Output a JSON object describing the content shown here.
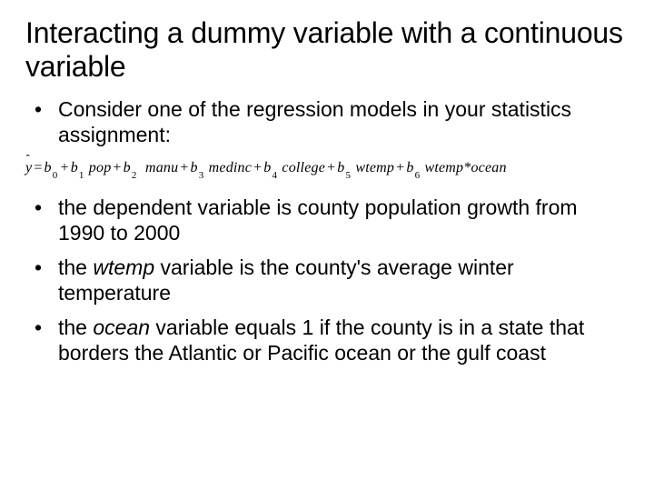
{
  "title": "Interacting a dummy variable with a continuous variable",
  "bullets_top": [
    "Consider one of the regression models in your statistics assignment:"
  ],
  "equation": {
    "yhat": "y",
    "eq": "=",
    "plus": "+",
    "star": "*",
    "b": "b",
    "sub0": "0",
    "sub1": "1",
    "sub2": "2",
    "sub3": "3",
    "sub4": "4",
    "sub5": "5",
    "sub6": "6",
    "pop": "pop",
    "manu": "manu",
    "medinc": "medinc",
    "college": "college",
    "wtemp": "wtemp",
    "ocean": "ocean"
  },
  "bullets_bottom": [
    {
      "text": "the dependent variable is county population growth from 1990 to 2000"
    },
    {
      "pre": "the ",
      "ital": "wtemp",
      "post": " variable is the county's average winter temperature"
    },
    {
      "pre": "the ",
      "ital": "ocean",
      "post": " variable equals 1 if the county is in a state that borders the Atlantic or Pacific ocean or the gulf coast"
    }
  ]
}
